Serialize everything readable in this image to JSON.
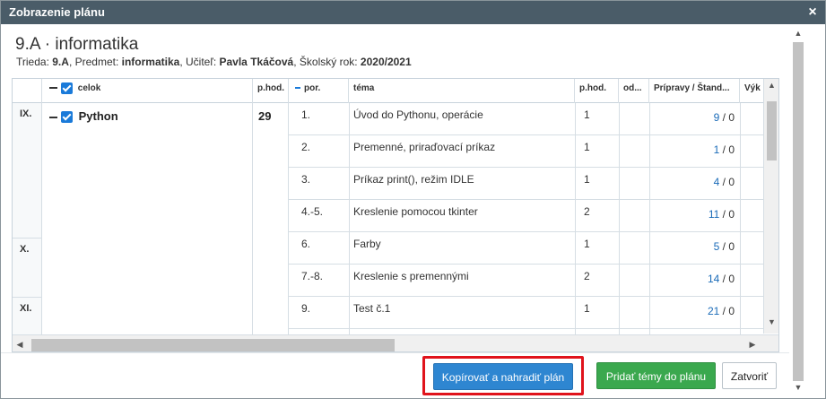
{
  "dialog": {
    "title": "Zobrazenie plánu",
    "close_icon": "×"
  },
  "plan": {
    "title": "9.A · informatika",
    "meta": {
      "trieda_label": "Trieda: ",
      "trieda": "9.A",
      "predmet_label": ", Predmet: ",
      "predmet": "informatika",
      "ucitel_label": ", Učiteľ: ",
      "ucitel": "Pavla Tkáčová",
      "rok_label": ", Školský rok: ",
      "rok": "2020/2021"
    }
  },
  "grid": {
    "headers": {
      "celok": "celok",
      "phod1": "p.hod.",
      "por": "por.",
      "tema": "téma",
      "phod2": "p.hod.",
      "od": "od...",
      "pripravy": "Prípravy / Štand...",
      "vyk": "Výk"
    },
    "months": [
      "IX.",
      "X.",
      "XI."
    ],
    "unit": {
      "name": "Python",
      "hours": "29"
    },
    "rows": [
      {
        "por": "1.",
        "tema": "Úvod do Pythonu, operácie",
        "phod": "1",
        "prip": "9",
        "stand": " / 0"
      },
      {
        "por": "2.",
        "tema": "Premenné, priraďovací príkaz",
        "phod": "1",
        "prip": "1",
        "stand": " / 0"
      },
      {
        "por": "3.",
        "tema": "Príkaz print(), režim IDLE",
        "phod": "1",
        "prip": "4",
        "stand": " / 0"
      },
      {
        "por": "4.-5.",
        "tema": "Kreslenie pomocou tkinter",
        "phod": "2",
        "prip": "11",
        "stand": " / 0"
      },
      {
        "por": "6.",
        "tema": "Farby",
        "phod": "1",
        "prip": "5",
        "stand": " / 0"
      },
      {
        "por": "7.-8.",
        "tema": "Kreslenie s premennými",
        "phod": "2",
        "prip": "14",
        "stand": " / 0"
      },
      {
        "por": "9.",
        "tema": "Test č.1",
        "phod": "1",
        "prip": "21",
        "stand": " / 0"
      }
    ]
  },
  "buttons": {
    "copy": "Kopírovať a nahradiť plán",
    "add": "Pridať témy do plánu",
    "close": "Zatvoriť"
  },
  "colors": {
    "titlebar": "#4a5c68",
    "primary": "#2e86d1",
    "success": "#3aa84e",
    "highlight": "#e0131c"
  }
}
